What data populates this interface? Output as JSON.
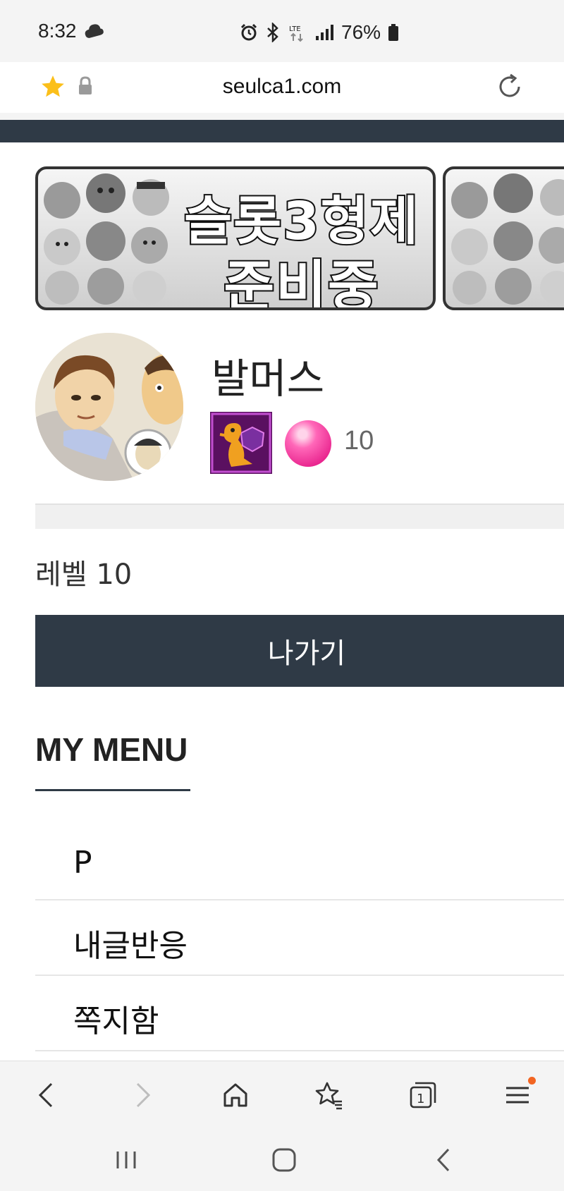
{
  "status_bar": {
    "time": "8:32",
    "battery": "76%",
    "network": "LTE"
  },
  "browser": {
    "url": "seulca1.com",
    "bottom_nav": [
      "back",
      "forward",
      "home",
      "bookmarks",
      "tabs",
      "menu"
    ],
    "tab_count": "1"
  },
  "banner": {
    "line1": "슬롯3형제",
    "line2": "준비중"
  },
  "profile": {
    "nickname": "발머스",
    "points": "10",
    "level_text": "레벨 10",
    "level_progress": 0
  },
  "logout_label": "나가기",
  "my_menu": {
    "title": "MY MENU",
    "items": [
      {
        "label": "P"
      },
      {
        "label": "내글반응"
      },
      {
        "label": "쪽지함"
      }
    ]
  },
  "colors": {
    "primary_dark": "#2f3a46",
    "star": "#fbbf1a",
    "notify_dot": "#f26522"
  }
}
